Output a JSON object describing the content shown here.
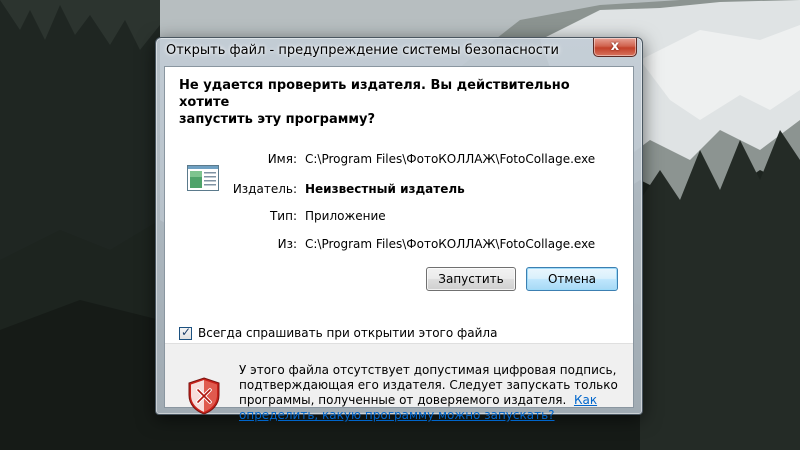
{
  "window": {
    "title": "Открыть файл - предупреждение системы безопасности",
    "close_label": "x"
  },
  "header": {
    "line1": "Не удается проверить издателя.  Вы действительно хотите",
    "line2": "запустить эту программу?"
  },
  "file_info": {
    "name_label": "Имя:",
    "name_value": "C:\\Program Files\\ФотоКОЛЛАЖ\\FotoCollage.exe",
    "publisher_label": "Издатель:",
    "publisher_value": "Неизвестный издатель",
    "type_label": "Тип:",
    "type_value": "Приложение",
    "from_label": "Из:",
    "from_value": "C:\\Program Files\\ФотоКОЛЛАЖ\\FotoCollage.exe"
  },
  "buttons": {
    "run_label": "Запустить",
    "cancel_label": "Отмена"
  },
  "always_ask": {
    "checked": true,
    "label": "Всегда спрашивать при открытии этого файла"
  },
  "warning": {
    "line1": "У этого файла отсутствует допустимая цифровая подпись,",
    "line2": "подтверждающая его издателя. Следует запускать только",
    "line3": "программы, полученные от доверяемого издателя.",
    "link_part1": "Как",
    "link_part2": "определить, какую программу можно запускать?"
  },
  "icons": {
    "program": "program-window-icon",
    "shield": "security-shield-x-icon",
    "close": "close-icon",
    "checkbox": "checkbox-checked-icon"
  },
  "colors": {
    "link": "#0066cc",
    "close_button": "#c2412a",
    "shield_red": "#c8211a"
  }
}
